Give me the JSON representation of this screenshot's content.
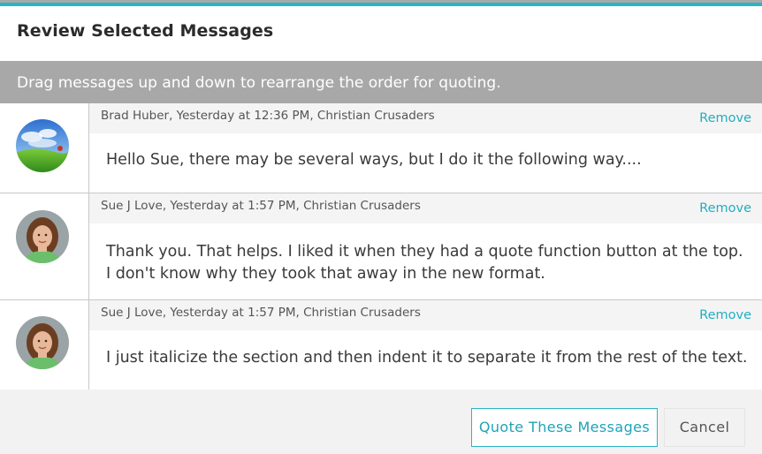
{
  "dialog": {
    "title": "Review Selected Messages",
    "hint": "Drag messages up and down to rearrange the order for quoting."
  },
  "messages": [
    {
      "meta": "Brad Huber, Yesterday at 12:36 PM, Christian Crusaders",
      "remove_label": "Remove",
      "lines": [
        "Hello Sue, there may be several ways, but I do it the following way...."
      ],
      "avatar": "landscape-avatar"
    },
    {
      "meta": "Sue J Love, Yesterday at 1:57 PM, Christian Crusaders",
      "remove_label": "Remove",
      "lines": [
        "Thank you. That helps. I liked it when they had a quote function button at the top.",
        "I don't know why they took that away in the new format."
      ],
      "avatar": "woman-avatar"
    },
    {
      "meta": "Sue J Love, Yesterday at 1:57 PM, Christian Crusaders",
      "remove_label": "Remove",
      "lines": [
        "I just italicize the section and then indent it to separate it from the rest of the text."
      ],
      "avatar": "woman-avatar"
    }
  ],
  "footer": {
    "quote_label": "Quote These Messages",
    "cancel_label": "Cancel"
  },
  "colors": {
    "accent": "#29b5c4",
    "hint_bar": "#a8a8a8",
    "link": "#21aec2"
  }
}
